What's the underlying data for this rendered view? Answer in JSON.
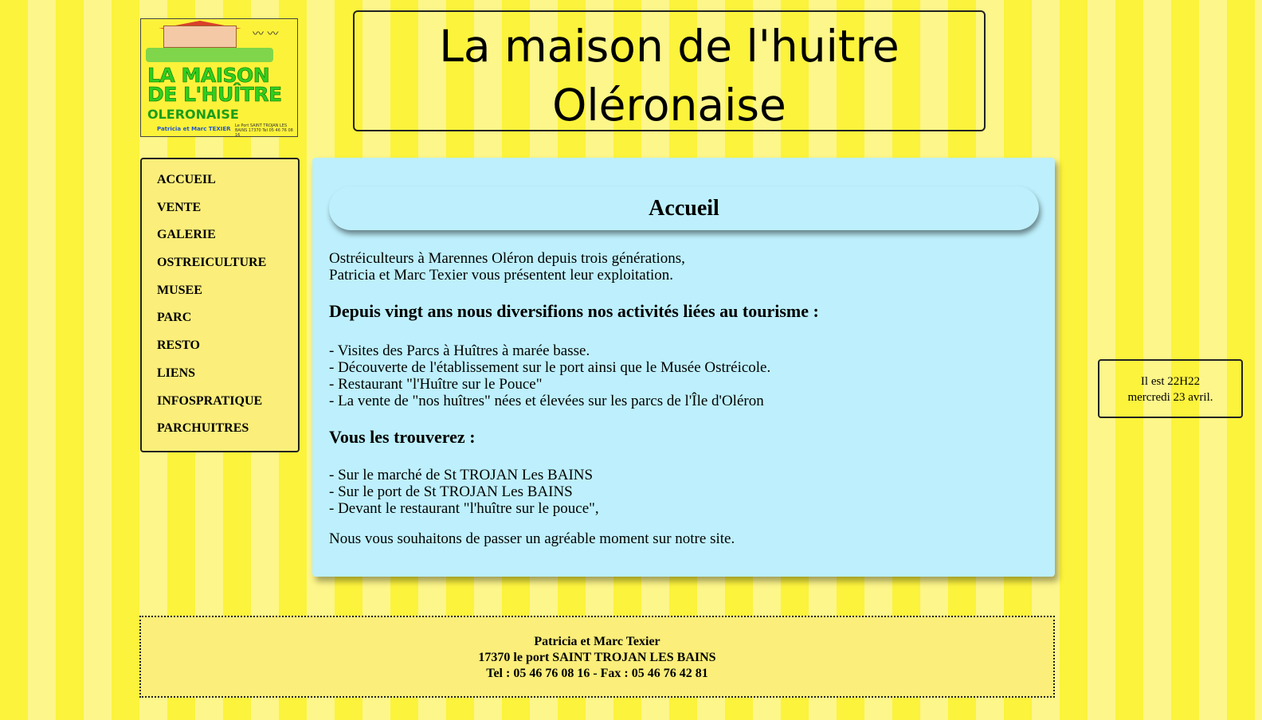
{
  "logo": {
    "line1": "LA MAISON",
    "line2": "DE L'HUÎTRE",
    "line3": "OLERONAISE",
    "owners": "Patricia et Marc TEXIER",
    "address_small": "Le Port SAINT TROJAN LES BAINS 17370 Tel 05 46 76 08 16"
  },
  "header": {
    "title_line1": "La maison de l'huitre",
    "title_line2": "Oléronaise"
  },
  "nav": {
    "items": [
      "ACCUEIL",
      "VENTE",
      "GALERIE",
      "OSTREICULTURE",
      "MUSEE",
      "PARC",
      "RESTO",
      "LIENS",
      "INFOSPRATIQUE",
      "PARCHUITRES"
    ]
  },
  "main": {
    "heading": "Accueil",
    "intro_line1": "Ostréiculteurs à Marennes Oléron depuis trois générations,",
    "intro_line2": "Patricia et Marc Texier vous présentent leur exploitation.",
    "section1_title": "Depuis vingt ans nous diversifions nos activités liées au tourisme :",
    "activities": [
      "- Visites des Parcs à Huîtres à marée basse.",
      "- Découverte de l'établissement sur le port ainsi que le Musée Ostréicole.",
      "- Restaurant \"l'Huître sur le Pouce\"",
      "- La vente de \"nos huîtres\" nées et élevées sur les parcs de l'Île d'Oléron"
    ],
    "section2_title": "Vous les trouverez :",
    "locations": [
      "- Sur le marché de St TROJAN Les BAINS",
      "- Sur le port de St TROJAN Les BAINS",
      "- Devant le restaurant \"l'huître sur le pouce\","
    ],
    "closing": "Nous vous souhaitons de passer un agréable moment sur notre site."
  },
  "clock": {
    "time": "Il est 22H22",
    "date": "mercredi 23 avril."
  },
  "footer": {
    "line1": "Patricia et Marc Texier",
    "line2": "17370 le port SAINT TROJAN LES BAINS",
    "line3": "Tel : 05 46 76 08 16 - Fax : 05 46 76 42 81"
  },
  "colors": {
    "stripe_dark": "#fcf33c",
    "stripe_light": "#fdf68a",
    "content_bg": "#bdf0fc",
    "panel_bg": "#fbee7a"
  }
}
